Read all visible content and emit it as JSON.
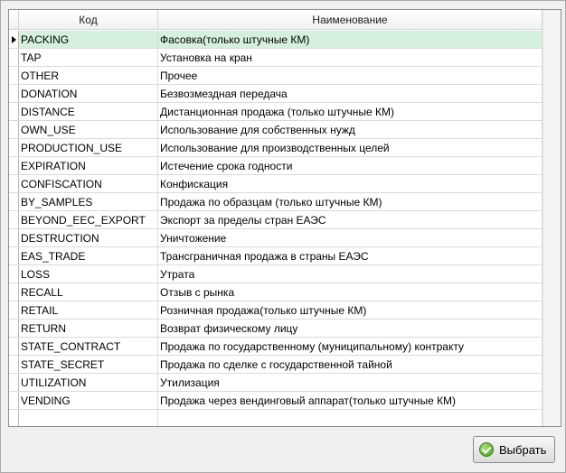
{
  "grid": {
    "columns": {
      "code": "Код",
      "name": "Наименование"
    },
    "selected_index": 0,
    "rows": [
      {
        "code": "PACKING",
        "name": "Фасовка(только штучные КМ)"
      },
      {
        "code": "TAP",
        "name": "Установка на кран"
      },
      {
        "code": "OTHER",
        "name": "Прочее"
      },
      {
        "code": "DONATION",
        "name": "Безвозмездная передача"
      },
      {
        "code": "DISTANCE",
        "name": "Дистанционная продажа (только штучные КМ)"
      },
      {
        "code": "OWN_USE",
        "name": "Использование для собственных нужд"
      },
      {
        "code": "PRODUCTION_USE",
        "name": "Использование для производственных целей"
      },
      {
        "code": "EXPIRATION",
        "name": "Истечение срока годности"
      },
      {
        "code": "CONFISCATION",
        "name": "Конфискация"
      },
      {
        "code": "BY_SAMPLES",
        "name": "Продажа по образцам (только штучные КМ)"
      },
      {
        "code": "BEYOND_EEC_EXPORT",
        "name": "Экспорт за пределы стран ЕАЭС"
      },
      {
        "code": "DESTRUCTION",
        "name": "Уничтожение"
      },
      {
        "code": "EAS_TRADE",
        "name": "Трансграничная продажа в страны ЕАЭС"
      },
      {
        "code": "LOSS",
        "name": "Утрата"
      },
      {
        "code": "RECALL",
        "name": "Отзыв с рынка"
      },
      {
        "code": "RETAIL",
        "name": "Розничная продажа(только штучные КМ)"
      },
      {
        "code": "RETURN",
        "name": "Возврат физическому лицу"
      },
      {
        "code": "STATE_CONTRACT",
        "name": "Продажа по государственному (муниципальному) контракту"
      },
      {
        "code": "STATE_SECRET",
        "name": "Продажа по сделке с государственной тайной"
      },
      {
        "code": "UTILIZATION",
        "name": "Утилизация"
      },
      {
        "code": "VENDING",
        "name": "Продажа через вендинговый аппарат(только штучные КМ)"
      }
    ]
  },
  "footer": {
    "select_label": "Выбрать",
    "select_icon": "green-check-icon"
  },
  "colors": {
    "selected_row": "#d6f0de",
    "window_bg": "#f0f0f0"
  }
}
